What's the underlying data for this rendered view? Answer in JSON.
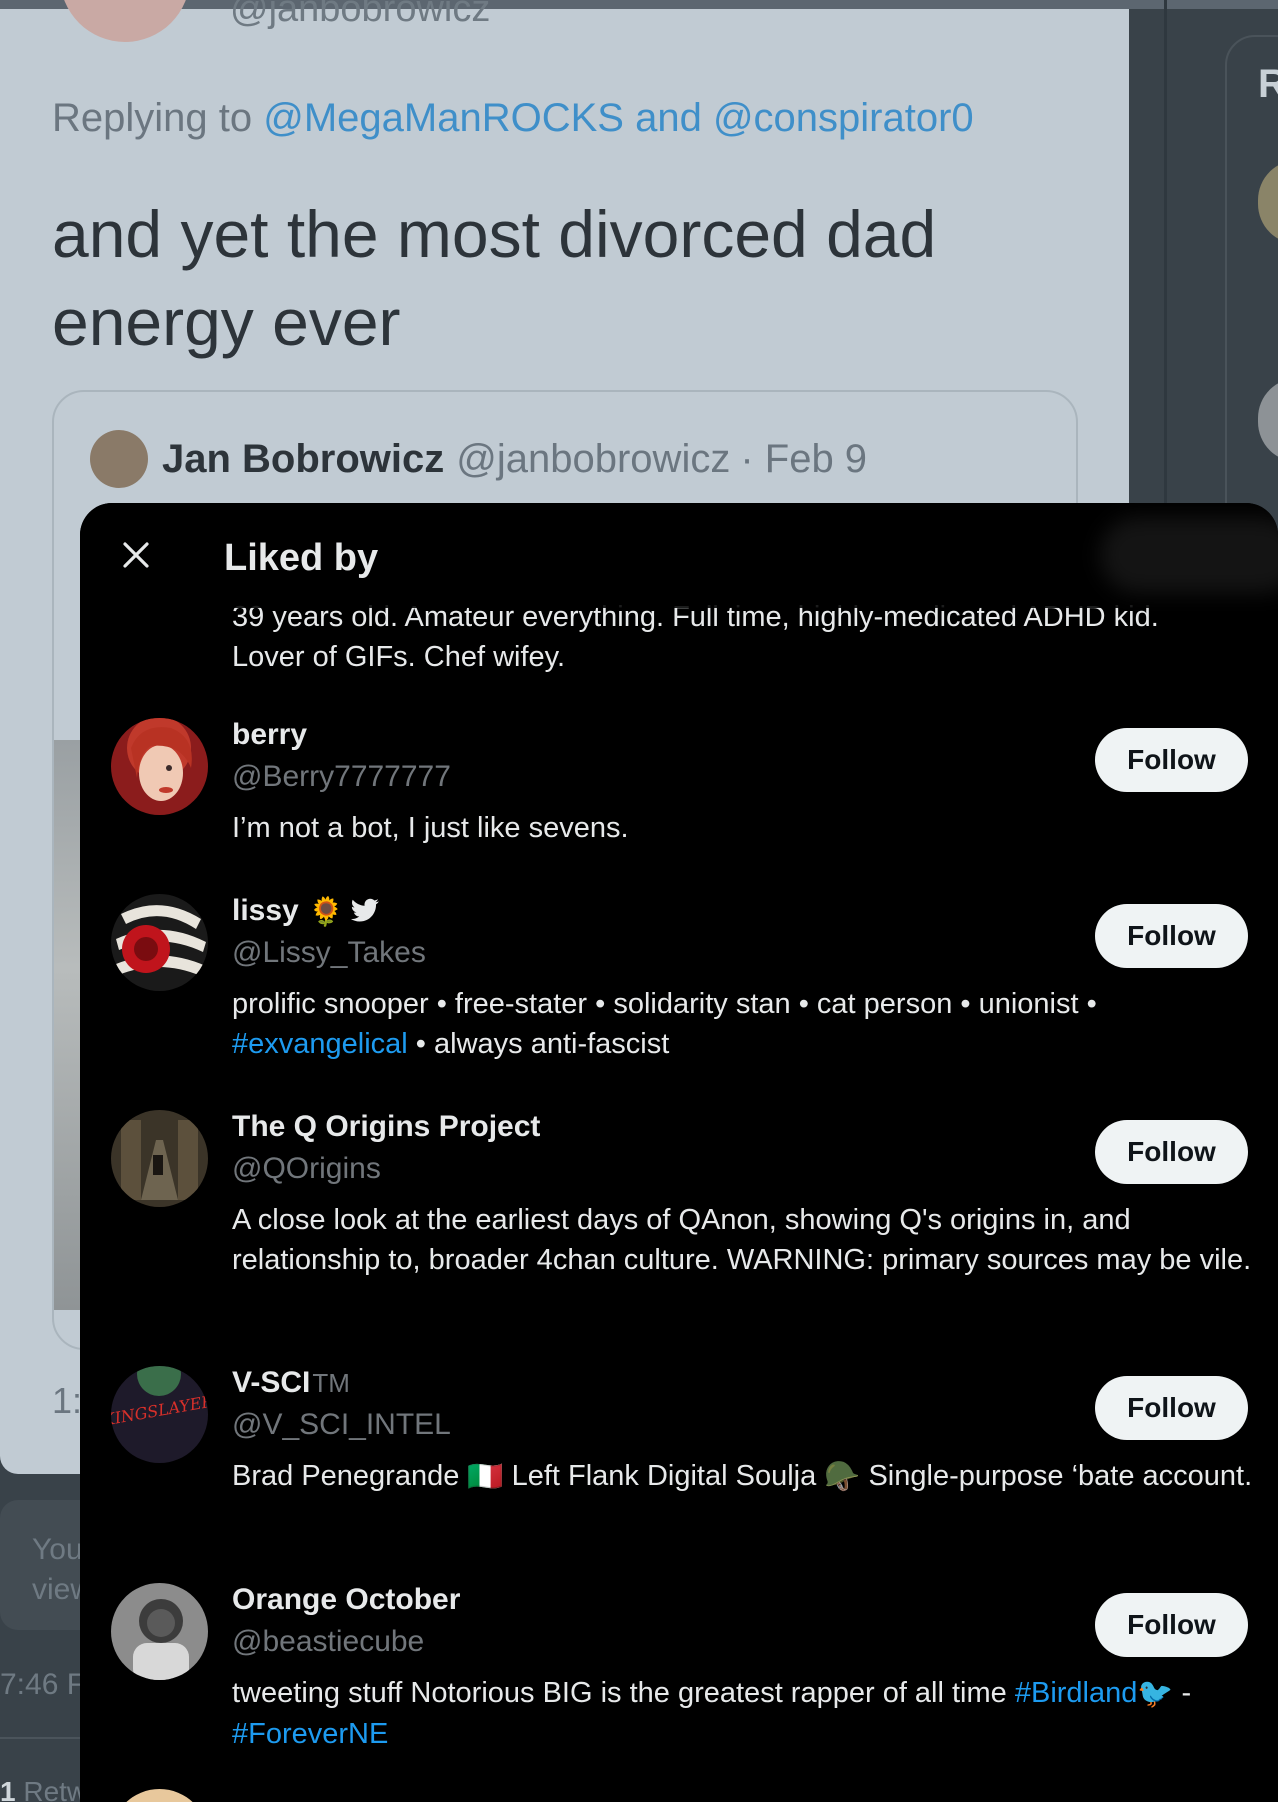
{
  "background": {
    "top_handle": "@janbobrowicz",
    "replying_prefix": "Replying to ",
    "replying_mention_1": "@MegaManROCKS",
    "replying_and": " and ",
    "replying_mention_2": "@conspirator0",
    "tweet_text": "and yet the most divorced dad energy ever",
    "quote_name": "Jan Bobrowicz",
    "quote_handle": "@janbobrowicz",
    "quote_date": "· Feb 9",
    "time_short": "1:",
    "reply_text": "You\nview",
    "time_long": "7:46 F",
    "retweet_count": "1",
    "retweet_label": " Retw",
    "right_panel_letter": "R"
  },
  "modal": {
    "title": "Liked by",
    "cut_bio_line1": "39 years old. Amateur everything. Full time, highly-medicated ADHD kid.",
    "cut_bio_line2": "Lover of GIFs. Chef wifey.",
    "follow_label": "Follow",
    "users": [
      {
        "name": "berry",
        "handle": "@Berry7777777",
        "bio": "I’m not a bot, I just like sevens."
      },
      {
        "name": "lissy",
        "name_emoji": "🌻",
        "handle": "@Lissy_Takes",
        "bio_part1": "prolific snooper • free-stater • solidarity stan • cat person • unionist •",
        "bio_tag": "#exvangelical",
        "bio_part2": " • always anti-fascist"
      },
      {
        "name": "The Q Origins Project",
        "handle": "@QOrigins",
        "bio": "A close look at the earliest days of QAnon, showing Q's origins in, and relationship to, broader 4chan culture. WARNING: primary sources may be vile."
      },
      {
        "name": "V-SCI",
        "name_suffix": "TM",
        "handle": "@V_SCI_INTEL",
        "avatar_text": "KINGSLAYER",
        "bio_part1": "Brad Penegrande ",
        "bio_flag": "🇮🇹",
        "bio_part2": " Left Flank Digital Soulja ",
        "bio_helmet": "🪖",
        "bio_part3": " Single-purpose ‘bate account."
      },
      {
        "name": "Orange October",
        "handle": "@beastiecube",
        "bio_part1": "tweeting stuff Notorious BIG is the greatest rapper of all time ",
        "bio_tag1": "#Birdland",
        "bio_bird": "🐦",
        "bio_part2": " -",
        "bio_tag2": "#ForeverNE"
      }
    ]
  }
}
